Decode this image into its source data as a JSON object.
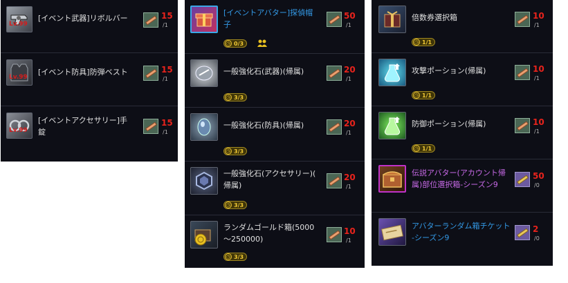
{
  "panel1": {
    "items": [
      {
        "name": "[イベント武器]リボルバー",
        "level": "Lv.99",
        "icon": "revolver-icon",
        "cost": "15",
        "cost_den": "/1"
      },
      {
        "name": "[イベント防具]防弾ベスト",
        "level": "Lv.99",
        "icon": "vest-icon",
        "cost": "15",
        "cost_den": "/1"
      },
      {
        "name_line1": "[イベントアクセサリー]手",
        "name_line2": "錠",
        "level": "Lv.99",
        "icon": "handcuffs-icon",
        "cost": "15",
        "cost_den": "/1"
      }
    ]
  },
  "panel2": {
    "items": [
      {
        "name_line1": "[イベントアバター]探偵帽",
        "name_line2": "子",
        "icon": "detective-hat-box-icon",
        "cost": "50",
        "cost_den": "/1",
        "badge": "0/3"
      },
      {
        "name": "一般強化石(武器)(帰属)",
        "icon": "weapon-stone-icon",
        "cost": "20",
        "cost_den": "/1",
        "badge": "3/3"
      },
      {
        "name": "一般強化石(防具)(帰属)",
        "icon": "armor-stone-icon",
        "cost": "20",
        "cost_den": "/1",
        "badge": "3/3"
      },
      {
        "name_line1": "一般強化石(アクセサリー)(",
        "name_line2": "帰属)",
        "icon": "accessory-stone-icon",
        "cost": "20",
        "cost_den": "/1",
        "badge": "3/3"
      },
      {
        "name_line1": "ランダムゴールド箱(5000",
        "name_line2": "〜250000)",
        "icon": "gold-box-icon",
        "cost": "10",
        "cost_den": "/1",
        "badge": "3/3"
      }
    ]
  },
  "panel3": {
    "items": [
      {
        "name": "倍数券選択箱",
        "icon": "multiplier-box-icon",
        "cost": "10",
        "cost_den": "/1",
        "badge": "1/1"
      },
      {
        "name": "攻撃ポーション(帰属)",
        "icon": "attack-potion-icon",
        "cost": "10",
        "cost_den": "/1",
        "badge": "1/1"
      },
      {
        "name": "防御ポーション(帰属)",
        "icon": "defense-potion-icon",
        "cost": "10",
        "cost_den": "/1",
        "badge": "1/1"
      },
      {
        "name_line1": "伝説アバター(アカウント帰",
        "name_line2": "属)部位選択箱-シーズン9",
        "icon": "legend-avatar-box-icon",
        "cost": "50",
        "cost_den": "/0"
      },
      {
        "name_line1": "アバターランダム箱チケット",
        "name_line2": "-シーズン9",
        "icon": "avatar-ticket-icon",
        "cost": "2",
        "cost_den": "/0"
      }
    ]
  },
  "colors": {
    "cost_red": "#e8231c",
    "name_blue": "#3399e6",
    "name_purple": "#c86ae8",
    "badge_gold": "#f0c835"
  }
}
